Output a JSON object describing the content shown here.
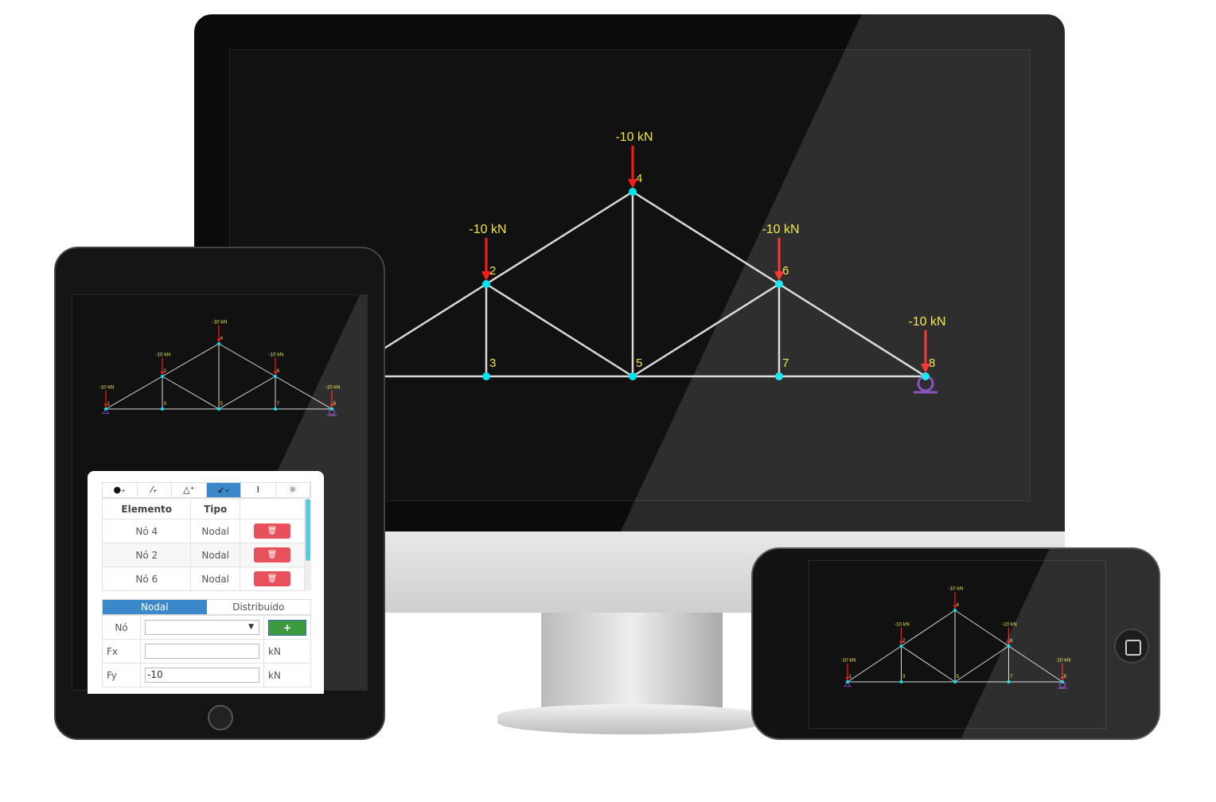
{
  "colors": {
    "member": "#d9d9d9",
    "node": "#00e5f0",
    "load": "#ff1a1a",
    "label": "#f0e640",
    "support": "#7a3db8",
    "active_tab": "#3a87c9",
    "delete": "#e8505b",
    "add": "#3e9a3e"
  },
  "truss": {
    "nodes": [
      "1",
      "2",
      "3",
      "4",
      "5",
      "6",
      "7",
      "8"
    ],
    "loads": [
      {
        "node": "1",
        "label": "-10 kN"
      },
      {
        "node": "2",
        "label": "-10 kN"
      },
      {
        "node": "4",
        "label": "-10 kN"
      },
      {
        "node": "6",
        "label": "-10 kN"
      },
      {
        "node": "8",
        "label": "-10 kN"
      }
    ],
    "supports": [
      {
        "node": "1",
        "type": "pin"
      },
      {
        "node": "8",
        "type": "roller"
      }
    ]
  },
  "panel": {
    "toolbar": [
      {
        "icon": "add-node-icon",
        "glyph": "●₊"
      },
      {
        "icon": "add-member-icon",
        "glyph": "⁄₊"
      },
      {
        "icon": "add-support-icon",
        "glyph": "△⁺"
      },
      {
        "icon": "add-load-icon",
        "glyph": "↙₊",
        "active": true
      },
      {
        "icon": "section-icon",
        "glyph": "I"
      },
      {
        "icon": "material-icon",
        "glyph": "⚛"
      }
    ],
    "table": {
      "headers": [
        "Elemento",
        "Tipo",
        ""
      ],
      "rows": [
        {
          "elemento": "Nó 4",
          "tipo": "Nodal",
          "action": "🗑"
        },
        {
          "elemento": "Nó 2",
          "tipo": "Nodal",
          "action": "🗑"
        },
        {
          "elemento": "Nó 6",
          "tipo": "Nodal",
          "action": "🗑"
        }
      ]
    },
    "tabs": {
      "nodal": "Nodal",
      "distribuido": "Distribuido"
    },
    "form": {
      "no_label": "Nó",
      "no_value": "",
      "add_label": "+",
      "fx_label": "Fx",
      "fx_value": "",
      "fx_unit": "kN",
      "fy_label": "Fy",
      "fy_value": "-10",
      "fy_unit": "kN"
    }
  }
}
